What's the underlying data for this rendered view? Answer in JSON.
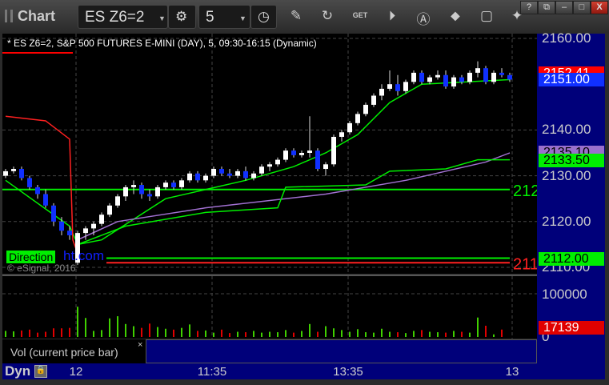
{
  "window": {
    "title": "Chart",
    "symbol": "ES Z6=2",
    "interval": "5",
    "buttons": [
      "?",
      "restore",
      "minimize",
      "maximize",
      "X"
    ]
  },
  "toolbar_icons": [
    "settings-icon",
    "clock-icon",
    "pencil-icon",
    "refresh-icon",
    "get-icon",
    "play-icon",
    "alert-icon",
    "link-icon",
    "comment-icon",
    "twitter-icon"
  ],
  "chart_header": "* ES Z6=2, S&P 500 FUTURES E-MINI (DAY), 5, 09:30-16:15 (Dynamic)",
  "watermark": {
    "label": "Direction",
    "suffix": "ht.com",
    "copyright": "© eSignal, 2016"
  },
  "colors": {
    "up": "#ffffff",
    "down": "#1030ff",
    "ma_green": "#00ee00",
    "ma_red": "#ff2020",
    "vwap": "#a070d0",
    "volume_up": "#40d000",
    "volume_down": "#e00000",
    "axis_bg": "#00007a"
  },
  "chart_data": {
    "type": "candlestick",
    "ylim": [
      2108,
      2163
    ],
    "y_ticks": [
      "2160.00",
      "2140.00",
      "2130.00",
      "2120.00",
      "2110.00"
    ],
    "y_tick_values": [
      2160,
      2140,
      2130,
      2120,
      2110
    ],
    "x_ticks": [
      {
        "label": "12",
        "bar": 8.8
      },
      {
        "label": "11:35",
        "bar": 25.8
      },
      {
        "label": "13:35",
        "bar": 42.8
      },
      {
        "label": "13",
        "bar": 63.3
      }
    ],
    "ohlc": [
      [
        2130,
        2131.5,
        2129.5,
        2131
      ],
      [
        2131,
        2132,
        2130.5,
        2131.5
      ],
      [
        2131.5,
        2132,
        2129,
        2129.5
      ],
      [
        2129.5,
        2130,
        2127,
        2127.5
      ],
      [
        2127.5,
        2128,
        2125,
        2126
      ],
      [
        2126,
        2127,
        2123,
        2123.5
      ],
      [
        2123.5,
        2124,
        2119,
        2120
      ],
      [
        2120,
        2121,
        2117,
        2118
      ],
      [
        2118,
        2119,
        2116,
        2117
      ],
      [
        2111,
        2118,
        2110.5,
        2117.5
      ],
      [
        2117.5,
        2119,
        2116,
        2118.5
      ],
      [
        2118.5,
        2120,
        2117,
        2119.5
      ],
      [
        2119.5,
        2122,
        2119,
        2121.5
      ],
      [
        2121.5,
        2124,
        2121,
        2123.5
      ],
      [
        2123.5,
        2126,
        2123,
        2125.5
      ],
      [
        2125.5,
        2128,
        2124.5,
        2127.5
      ],
      [
        2127.5,
        2129,
        2126,
        2128
      ],
      [
        2128,
        2128.5,
        2125,
        2126
      ],
      [
        2126,
        2127,
        2124.5,
        2125.5
      ],
      [
        2125.5,
        2128,
        2125,
        2127.5
      ],
      [
        2127.5,
        2129,
        2127,
        2128.5
      ],
      [
        2128.5,
        2129,
        2127,
        2127.5
      ],
      [
        2127.5,
        2129.5,
        2127,
        2129
      ],
      [
        2129,
        2131,
        2128.5,
        2130.5
      ],
      [
        2130.5,
        2131,
        2128.5,
        2129
      ],
      [
        2129,
        2130.5,
        2128.5,
        2130
      ],
      [
        2130,
        2132,
        2129.5,
        2131.5
      ],
      [
        2131.5,
        2132,
        2130,
        2130.5
      ],
      [
        2130.5,
        2131.5,
        2129.5,
        2130
      ],
      [
        2130,
        2131.5,
        2129.5,
        2131
      ],
      [
        2131,
        2132,
        2129,
        2129.5
      ],
      [
        2129.5,
        2131,
        2129,
        2130.5
      ],
      [
        2130.5,
        2132.5,
        2130,
        2132
      ],
      [
        2132,
        2133,
        2131,
        2132.5
      ],
      [
        2132.5,
        2134,
        2132,
        2133.5
      ],
      [
        2133.5,
        2136,
        2133,
        2135.5
      ],
      [
        2135.5,
        2136,
        2134,
        2134.5
      ],
      [
        2134.5,
        2135.5,
        2134,
        2135
      ],
      [
        2135,
        2143,
        2134,
        2135.5
      ],
      [
        2135.5,
        2136,
        2131,
        2131.5
      ],
      [
        2131.5,
        2133,
        2130,
        2132.5
      ],
      [
        2132.5,
        2139,
        2132,
        2138.5
      ],
      [
        2138.5,
        2140,
        2137.5,
        2139.5
      ],
      [
        2139.5,
        2142,
        2139,
        2141.5
      ],
      [
        2141.5,
        2144,
        2141,
        2143.5
      ],
      [
        2143.5,
        2146,
        2143,
        2145.5
      ],
      [
        2145.5,
        2148,
        2145,
        2147.5
      ],
      [
        2147.5,
        2150,
        2146.5,
        2149
      ],
      [
        2149,
        2153,
        2148.5,
        2150
      ],
      [
        2150,
        2152,
        2147.5,
        2148.5
      ],
      [
        2148.5,
        2151,
        2148,
        2150.5
      ],
      [
        2150.5,
        2153,
        2150,
        2152.5
      ],
      [
        2152.5,
        2153,
        2150,
        2150.5
      ],
      [
        2150.5,
        2152,
        2150,
        2151.5
      ],
      [
        2151.5,
        2153,
        2151,
        2152
      ],
      [
        2152,
        2153,
        2149,
        2149.5
      ],
      [
        2149.5,
        2152,
        2149,
        2151.5
      ],
      [
        2151.5,
        2152,
        2150,
        2150.5
      ],
      [
        2150.5,
        2153,
        2150,
        2152.5
      ],
      [
        2152.5,
        2155,
        2151.5,
        2153.5
      ],
      [
        2153.5,
        2154,
        2150,
        2150.5
      ],
      [
        2150.5,
        2153,
        2150,
        2152.5
      ],
      [
        2152.5,
        2153.5,
        2151.5,
        2152
      ],
      [
        2152,
        2152.5,
        2150.5,
        2151
      ]
    ],
    "lines": [
      {
        "color": "#00ee00",
        "points": [
          [
            0,
            2129
          ],
          [
            8,
            2119
          ],
          [
            9,
            2115
          ],
          [
            12,
            2116
          ],
          [
            20,
            2125
          ],
          [
            30,
            2129
          ],
          [
            36,
            2132
          ],
          [
            40,
            2135
          ],
          [
            44,
            2139
          ],
          [
            48,
            2146
          ],
          [
            52,
            2150
          ],
          [
            63,
            2151
          ]
        ]
      },
      {
        "color": "#ff2020",
        "points": [
          [
            0,
            2143
          ],
          [
            5,
            2142
          ],
          [
            8,
            2138
          ],
          [
            8.4,
            2116
          ],
          [
            9,
            2113
          ]
        ]
      },
      {
        "color": "#a070d0",
        "points": [
          [
            9,
            2116
          ],
          [
            14,
            2120
          ],
          [
            25,
            2123
          ],
          [
            40,
            2126
          ],
          [
            50,
            2129
          ],
          [
            60,
            2133
          ],
          [
            63,
            2135
          ]
        ]
      },
      {
        "color": "#00ee00",
        "points": [
          [
            9,
            2115
          ],
          [
            15,
            2119
          ],
          [
            25,
            2122
          ],
          [
            34,
            2123
          ],
          [
            35,
            2127.5
          ],
          [
            45,
            2128
          ],
          [
            48,
            2131
          ],
          [
            55,
            2131.5
          ],
          [
            59,
            2133.5
          ],
          [
            63,
            2133.5
          ]
        ]
      }
    ],
    "hlines": [
      {
        "value": 2127,
        "color": "#00ee00",
        "label": "212"
      },
      {
        "value": 2112,
        "color": "#00ee00",
        "label": ""
      },
      {
        "value": 2111,
        "color": "#ff2020",
        "label": "211"
      }
    ],
    "price_tags": [
      {
        "label": "2152.41",
        "value": 2152.41,
        "bg": "#ff0000",
        "fg": "#ffffff"
      },
      {
        "label": "2151.00",
        "value": 2151,
        "bg": "#1030ff",
        "fg": "#ffffff"
      },
      {
        "label": "2135.10",
        "value": 2135.1,
        "bg": "#9a70cc",
        "fg": "#000000"
      },
      {
        "label": "2133.50",
        "value": 2133.5,
        "bg": "#00ee00",
        "fg": "#000000"
      },
      {
        "label": "2112.00",
        "value": 2112,
        "bg": "#00ee00",
        "fg": "#000000"
      }
    ],
    "volume": {
      "label": "Vol (current price bar)",
      "ylim": [
        0,
        130000
      ],
      "y_ticks": [
        "100000",
        "0"
      ],
      "last_tag": "17139",
      "values": [
        14000,
        13000,
        15000,
        17000,
        10000,
        12000,
        20000,
        20000,
        21000,
        70000,
        44000,
        14000,
        16000,
        43000,
        48000,
        30000,
        25000,
        21000,
        31000,
        23000,
        19000,
        17000,
        21000,
        29000,
        14000,
        15000,
        10000,
        17000,
        9000,
        12000,
        11000,
        14000,
        10000,
        12000,
        11000,
        16000,
        10000,
        14000,
        30000,
        12000,
        25000,
        20000,
        16000,
        12000,
        18000,
        11000,
        10000,
        19000,
        12000,
        11000,
        9000,
        14000,
        16000,
        12000,
        11000,
        10000,
        14000,
        12000,
        10000,
        45000,
        26000,
        6000,
        17139
      ]
    }
  },
  "bottom": {
    "mode": "Dyn"
  }
}
